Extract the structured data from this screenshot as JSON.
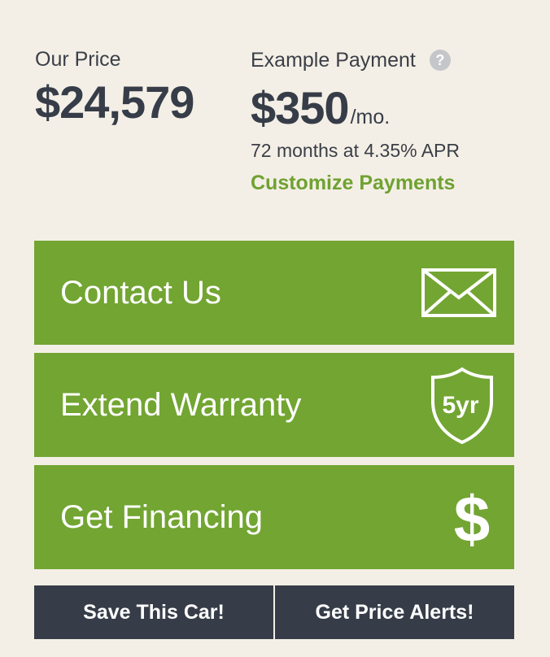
{
  "pricing": {
    "our_price_label": "Our Price",
    "our_price_value": "$24,579",
    "payment_label": "Example Payment",
    "payment_help_icon": "question-icon",
    "payment_help_glyph": "?",
    "payment_value": "$350",
    "payment_suffix": "/mo.",
    "payment_terms": "72 months at 4.35% APR",
    "customize_link": "Customize Payments"
  },
  "actions": [
    {
      "label": "Contact Us",
      "icon": "envelope-icon"
    },
    {
      "label": "Extend Warranty",
      "icon": "warranty-shield-icon",
      "icon_text": "5yr"
    },
    {
      "label": "Get Financing",
      "icon": "dollar-icon",
      "icon_text": "$"
    }
  ],
  "bottom_buttons": {
    "save_label": "Save This Car!",
    "alerts_label": "Get Price Alerts!"
  },
  "colors": {
    "background": "#f4efe6",
    "accent_green": "#72a532",
    "link_green": "#6fa231",
    "dark": "#363d48",
    "help_gray": "#c4c6ca"
  }
}
